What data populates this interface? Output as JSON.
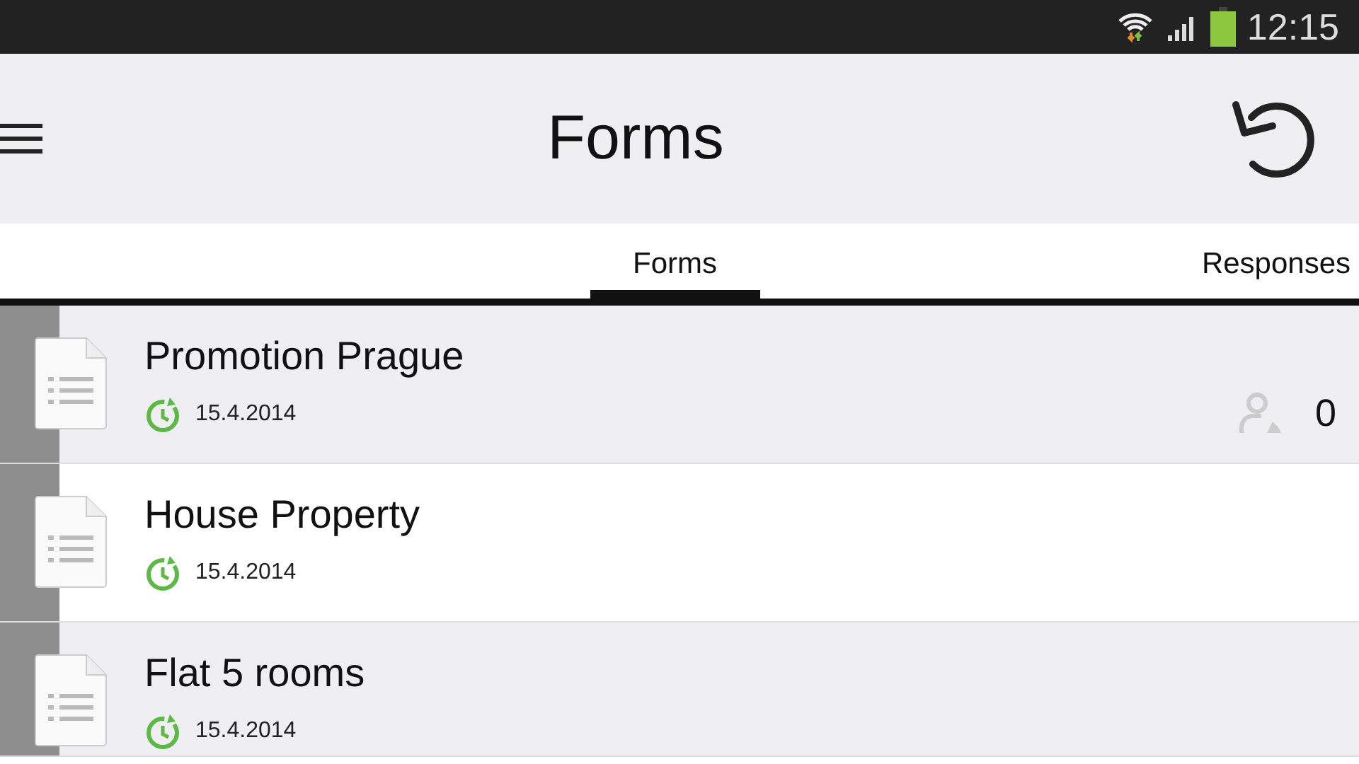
{
  "status_bar": {
    "time": "12:15"
  },
  "app_bar": {
    "title": "Forms"
  },
  "tabs": [
    {
      "label": "Forms",
      "selected": true
    },
    {
      "label": "Responses",
      "selected": false
    }
  ],
  "forms": [
    {
      "title": "Promotion Prague",
      "date": "15.4.2014",
      "responses": "0"
    },
    {
      "title": "House Property",
      "date": "15.4.2014"
    },
    {
      "title": "Flat 5 rooms",
      "date": "15.4.2014"
    }
  ]
}
